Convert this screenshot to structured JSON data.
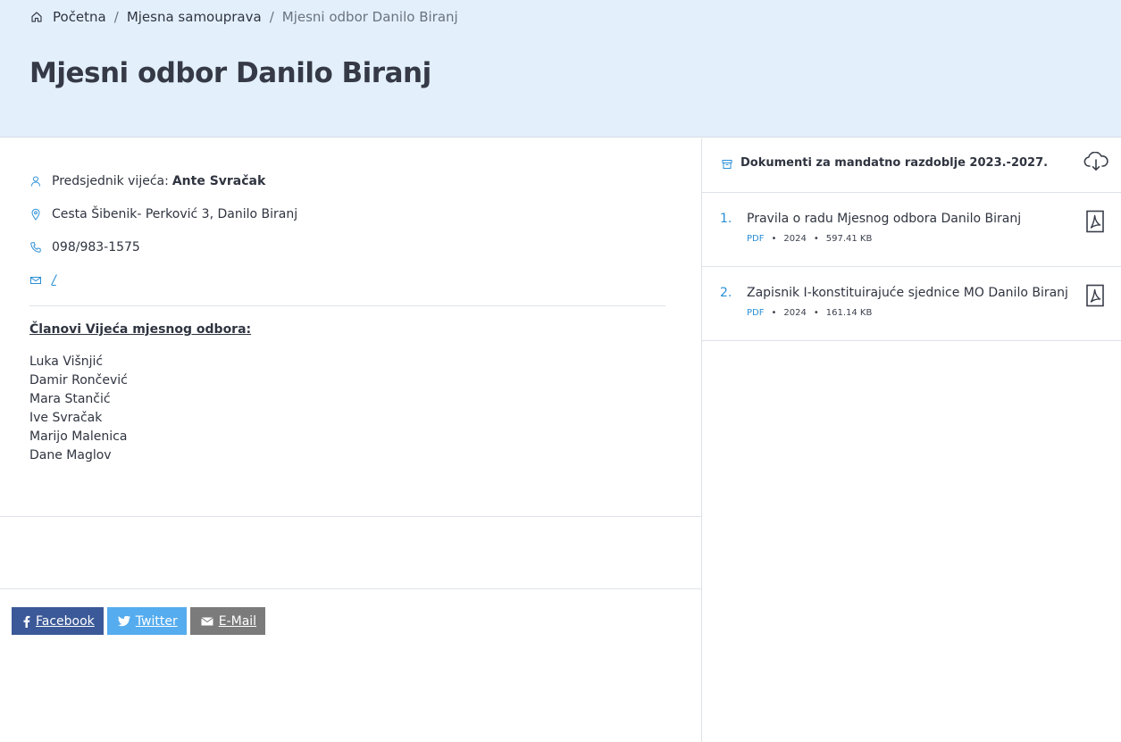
{
  "breadcrumb": {
    "home_icon": "home-icon",
    "items": [
      "Početna",
      "Mjesna samouprava"
    ],
    "separator": "/",
    "current": "Mjesni odbor Danilo Biranj"
  },
  "page": {
    "title": "Mjesni odbor Danilo Biranj"
  },
  "info": {
    "president_label": "Predsjednik vijeća:",
    "president_name": "Ante Svračak",
    "address": "Cesta Šibenik- Perković 3, Danilo Biranj",
    "phone": "098/983-1575",
    "email": "/"
  },
  "members": {
    "title": "Članovi Vijeća mjesnog odbora:",
    "names": [
      "Luka Višnjić",
      "Damir Rončević",
      "Mara Stančić",
      "Ive Svračak",
      "Marijo Malenica",
      "Dane Maglov"
    ]
  },
  "share": {
    "facebook": "Facebook",
    "twitter": "Twitter",
    "email": "E-Mail",
    "colors": {
      "facebook": "#3b5998",
      "twitter": "#55acee",
      "email": "#7b7b7b"
    }
  },
  "documents": {
    "title": "Dokumenti za mandatno razdoblje 2023.-2027.",
    "download_icon": "cloud-download-icon",
    "items": [
      {
        "num": "1.",
        "name": "Pravila o radu Mjesnog odbora Danilo Biranj",
        "type": "PDF",
        "year": "2024",
        "size": "597.41 KB"
      },
      {
        "num": "2.",
        "name": "Zapisnik I-konstituirajuće sjednice MO Danilo Biranj",
        "type": "PDF",
        "year": "2024",
        "size": "161.14 KB"
      }
    ]
  },
  "colors": {
    "accent": "#2a8fd6",
    "hero_bg": "#e3f0fb",
    "text": "#2f3440"
  }
}
